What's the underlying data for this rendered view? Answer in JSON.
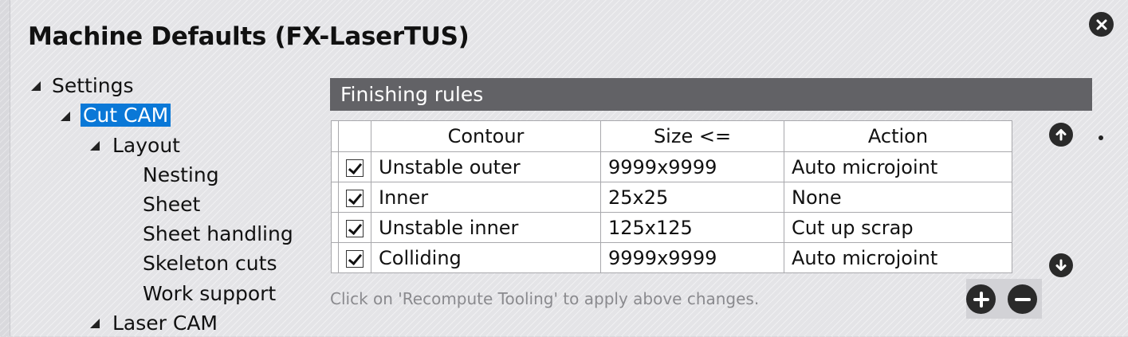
{
  "dialog": {
    "title": "Machine Defaults (FX-LaserTUS)"
  },
  "tree": {
    "root": "Settings",
    "cut_cam": "Cut CAM",
    "layout": "Layout",
    "layout_children": [
      "Nesting",
      "Sheet",
      "Sheet handling",
      "Skeleton cuts",
      "Work support"
    ],
    "laser_cam": "Laser CAM"
  },
  "finishing": {
    "section_title": "Finishing rules",
    "columns": [
      "Contour",
      "Size <=",
      "Action"
    ],
    "rows": [
      {
        "checked": true,
        "contour": "Unstable outer",
        "size": "9999x9999",
        "action": "Auto microjoint"
      },
      {
        "checked": true,
        "contour": "Inner",
        "size": "25x25",
        "action": "None"
      },
      {
        "checked": true,
        "contour": "Unstable inner",
        "size": "125x125",
        "action": "Cut up scrap"
      },
      {
        "checked": true,
        "contour": "Colliding",
        "size": "9999x9999",
        "action": "Auto microjoint"
      }
    ],
    "hint": "Click on 'Recompute Tooling' to apply above changes."
  },
  "icons": {
    "close": "close-icon",
    "move_up": "arrow-up-icon",
    "move_down": "arrow-down-icon",
    "add": "plus-icon",
    "remove": "minus-icon"
  },
  "colors": {
    "selection": "#0a78d7",
    "section_bar": "#626266",
    "icon_fill": "#2a2a2a"
  }
}
